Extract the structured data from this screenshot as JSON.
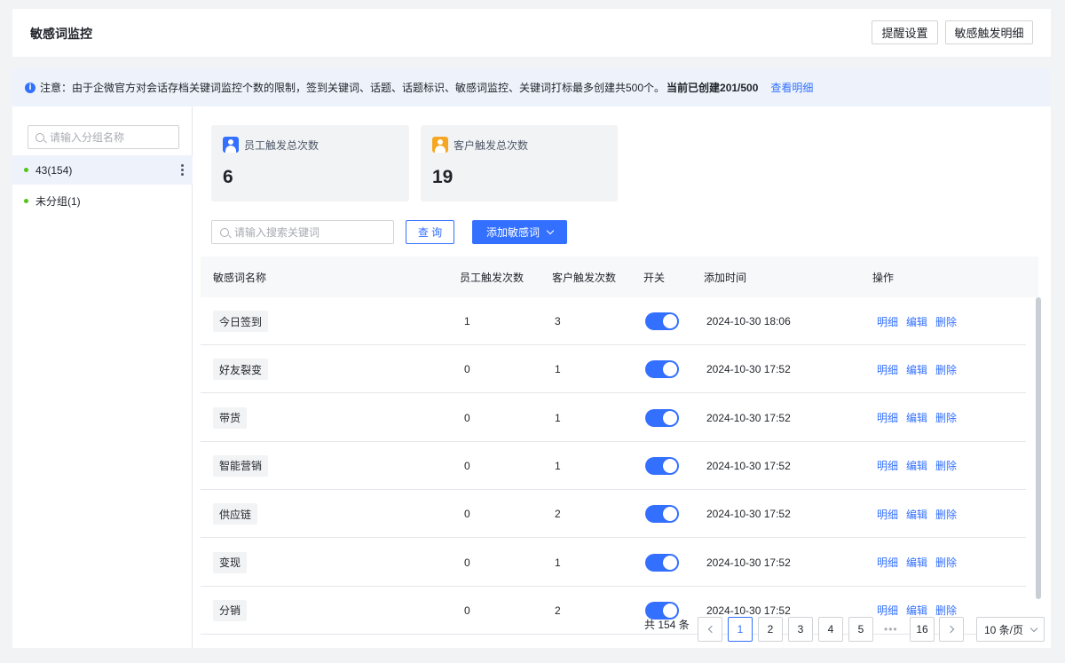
{
  "header": {
    "title": "敏感词监控",
    "buttons": [
      "提醒设置",
      "敏感触发明细"
    ]
  },
  "notice": {
    "icon": "info-icon",
    "text": "注意：由于企微官方对会话存档关键词监控个数的限制，签到关键词、话题、话题标识、敏感词监控、关键词打标最多创建共500个。",
    "count_text": "当前已创建201/500",
    "link": "查看明细"
  },
  "sidebar": {
    "search_placeholder": "请输入分组名称",
    "groups": [
      {
        "label": "43(154)"
      },
      {
        "label": "未分组(1)"
      }
    ]
  },
  "stats": [
    {
      "label": "员工触发总次数",
      "value": "6",
      "icon": "employee-icon",
      "color": "#3370ff"
    },
    {
      "label": "客户触发总次数",
      "value": "19",
      "icon": "customer-icon",
      "color": "#f5a623"
    }
  ],
  "toolbar": {
    "search_placeholder": "请输入搜索关键词",
    "query_label": "查 询",
    "add_label": "添加敏感词"
  },
  "table": {
    "columns": [
      "敏感词名称",
      "员工触发次数",
      "客户触发次数",
      "开关",
      "添加时间",
      "操作"
    ],
    "actions": [
      "明细",
      "编辑",
      "删除"
    ],
    "rows": [
      {
        "name": "今日签到",
        "emp": "1",
        "cust": "3",
        "on": true,
        "time": "2024-10-30 18:06"
      },
      {
        "name": "好友裂变",
        "emp": "0",
        "cust": "1",
        "on": true,
        "time": "2024-10-30 17:52"
      },
      {
        "name": "带货",
        "emp": "0",
        "cust": "1",
        "on": true,
        "time": "2024-10-30 17:52"
      },
      {
        "name": "智能营销",
        "emp": "0",
        "cust": "1",
        "on": true,
        "time": "2024-10-30 17:52"
      },
      {
        "name": "供应链",
        "emp": "0",
        "cust": "2",
        "on": true,
        "time": "2024-10-30 17:52"
      },
      {
        "name": "变现",
        "emp": "0",
        "cust": "1",
        "on": true,
        "time": "2024-10-30 17:52"
      },
      {
        "name": "分销",
        "emp": "0",
        "cust": "2",
        "on": true,
        "time": "2024-10-30 17:52"
      }
    ]
  },
  "pagination": {
    "total": "共 154 条",
    "pages": [
      "1",
      "2",
      "3",
      "4",
      "5"
    ],
    "ellipsis": "•••",
    "last": "16",
    "current": "1",
    "page_size": "10 条/页"
  },
  "colors": {
    "accent": "#3370ff",
    "group_dot": "#52c41a",
    "notice_bg": "#eef3fb"
  }
}
